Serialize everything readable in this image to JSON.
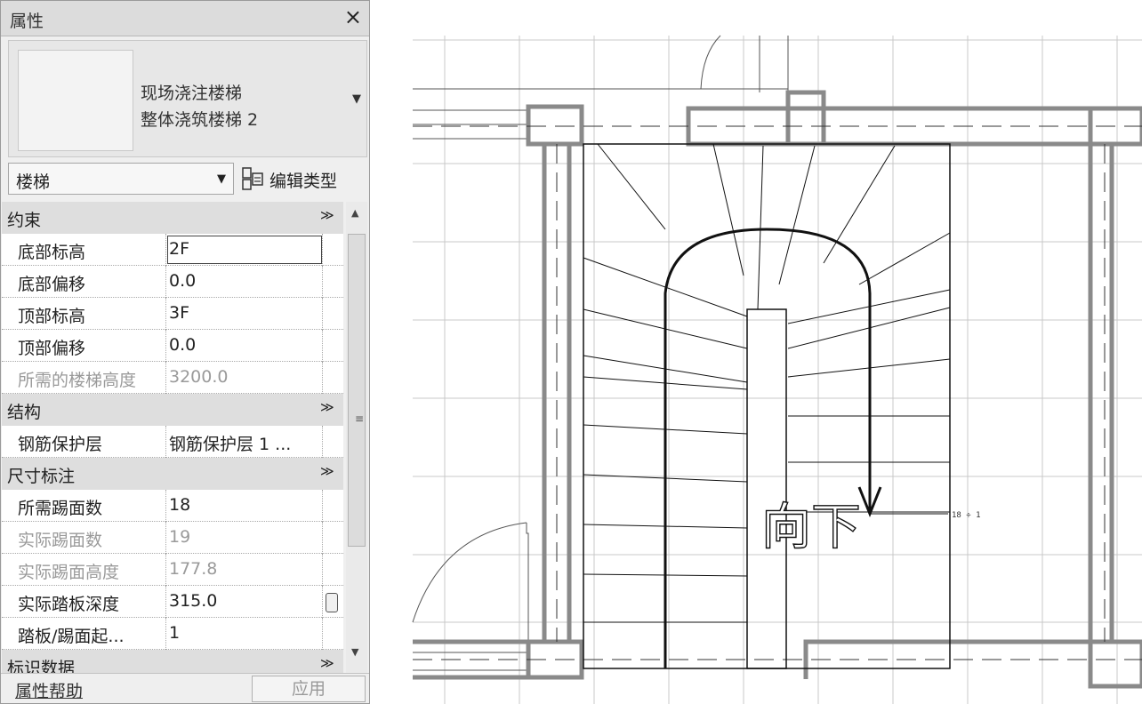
{
  "panel": {
    "title": "属性",
    "close_glyph": "×",
    "type_selector": {
      "family": "现场浇注楼梯",
      "type": "整体浇筑楼梯 2",
      "dropdown_glyph": "▼"
    },
    "category": {
      "label": "楼梯",
      "arrow": "▼"
    },
    "edit_type_label": "编辑类型",
    "groups": [
      {
        "name": "约束",
        "collapse_glyph": "≫",
        "rows": [
          {
            "label": "底部标高",
            "value": "2F",
            "read_only": false
          },
          {
            "label": "底部偏移",
            "value": "0.0",
            "read_only": false
          },
          {
            "label": "顶部标高",
            "value": "3F",
            "read_only": false
          },
          {
            "label": "顶部偏移",
            "value": "0.0",
            "read_only": false
          },
          {
            "label": "所需的楼梯高度",
            "value": "3200.0",
            "read_only": true
          }
        ]
      },
      {
        "name": "结构",
        "collapse_glyph": "≫",
        "rows": [
          {
            "label": "钢筋保护层",
            "value": "钢筋保护层 1 ...",
            "read_only": false
          }
        ]
      },
      {
        "name": "尺寸标注",
        "collapse_glyph": "≫",
        "rows": [
          {
            "label": "所需踢面数",
            "value": "18",
            "read_only": false
          },
          {
            "label": "实际踢面数",
            "value": "19",
            "read_only": true
          },
          {
            "label": "实际踢面高度",
            "value": "177.8",
            "read_only": true
          },
          {
            "label": "实际踏板深度",
            "value": "315.0",
            "read_only": false
          },
          {
            "label": "踏板/踢面起...",
            "value": "1",
            "read_only": false
          }
        ]
      },
      {
        "name": "标识数据",
        "collapse_glyph": "≫",
        "rows": []
      }
    ],
    "footer": {
      "help_label": "属性帮助",
      "apply_label": "应用"
    }
  },
  "drawing": {
    "direction_label": "向下",
    "riser_count_label": "18 ÷ 1"
  },
  "colors": {
    "wall": "#8a8a8a",
    "grid": "#c9c9c9",
    "stair": "#111111",
    "panel_bg": "#efefef"
  }
}
